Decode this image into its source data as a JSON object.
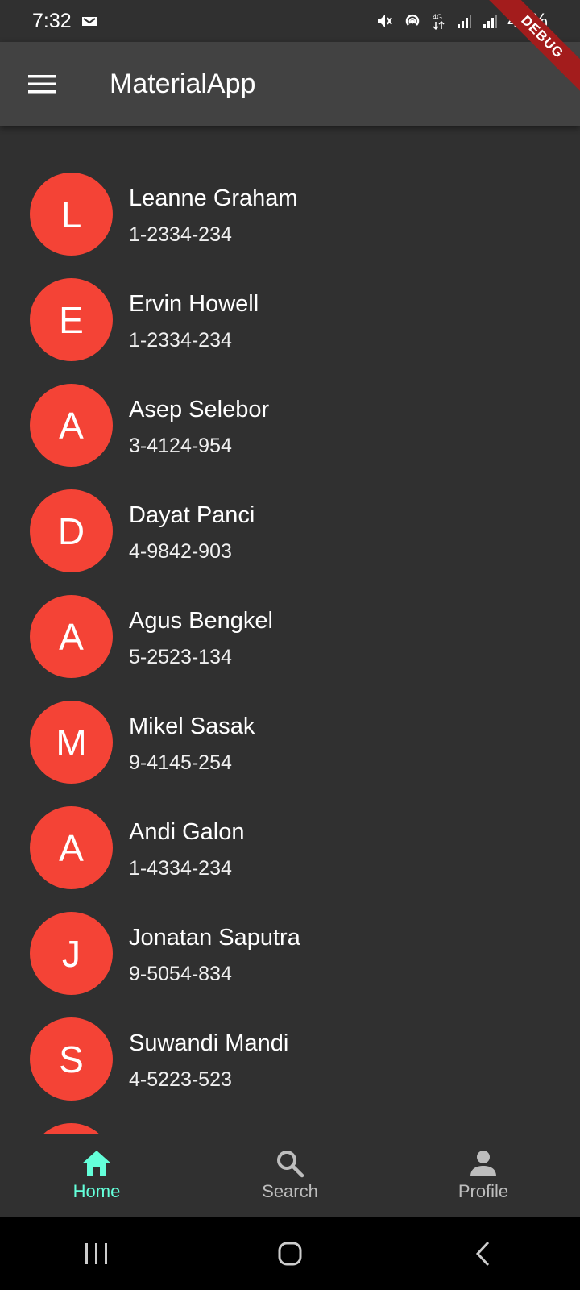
{
  "status_bar": {
    "time": "7:32",
    "battery": "44%"
  },
  "appbar": {
    "title": "MaterialApp",
    "menu_icon": "hamburger-menu-icon"
  },
  "debug_banner": "DEBUG",
  "contacts": [
    {
      "initial": "L",
      "name": "Leanne Graham",
      "phone": "1-2334-234"
    },
    {
      "initial": "E",
      "name": "Ervin Howell",
      "phone": "1-2334-234"
    },
    {
      "initial": "A",
      "name": "Asep Selebor",
      "phone": "3-4124-954"
    },
    {
      "initial": "D",
      "name": "Dayat Panci",
      "phone": "4-9842-903"
    },
    {
      "initial": "A",
      "name": "Agus Bengkel",
      "phone": "5-2523-134"
    },
    {
      "initial": "M",
      "name": "Mikel Sasak",
      "phone": "9-4145-254"
    },
    {
      "initial": "A",
      "name": "Andi Galon",
      "phone": "1-4334-234"
    },
    {
      "initial": "J",
      "name": "Jonatan Saputra",
      "phone": "9-5054-834"
    },
    {
      "initial": "S",
      "name": "Suwandi Mandi",
      "phone": "4-5223-523"
    }
  ],
  "bottom_nav": [
    {
      "label": "Home",
      "icon": "home-icon",
      "active": true
    },
    {
      "label": "Search",
      "icon": "search-icon",
      "active": false
    },
    {
      "label": "Profile",
      "icon": "person-icon",
      "active": false
    }
  ],
  "colors": {
    "avatar": "#f44336",
    "active_tab": "#64ffda",
    "background": "#303030",
    "appbar": "#424242"
  }
}
